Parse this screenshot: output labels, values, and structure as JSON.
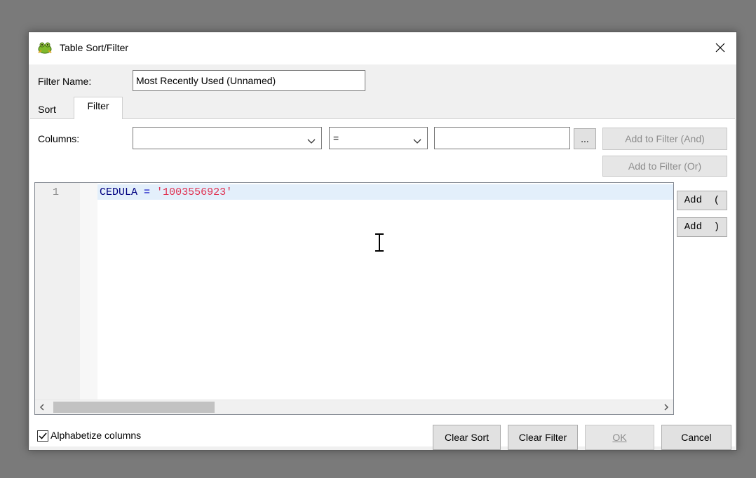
{
  "dialog": {
    "title": "Table Sort/Filter",
    "icons": {
      "app": "frog-icon",
      "close": "close-icon"
    }
  },
  "filter_name": {
    "label": "Filter Name:",
    "value": "Most Recently Used (Unnamed)"
  },
  "tabs": [
    {
      "label": "Sort",
      "active": false
    },
    {
      "label": "Filter",
      "active": true
    }
  ],
  "filter_tab": {
    "columns_label": "Columns:",
    "column_select": {
      "value": ""
    },
    "operator_select": {
      "value": "="
    },
    "value_input": {
      "value": ""
    },
    "ellipsis_label": "...",
    "add_and_label": "Add to Filter (And)",
    "add_or_label": "Add to Filter (Or)",
    "add_open_paren_label": "Add  (",
    "add_close_paren_label": "Add  )"
  },
  "editor": {
    "line_number": "1",
    "tokens": {
      "identifier": "CEDULA",
      "operator": "=",
      "string": "'1003556923'"
    }
  },
  "footer": {
    "alphabetize_label": "Alphabetize columns",
    "alphabetize_checked": true,
    "clear_sort_label": "Clear Sort",
    "clear_filter_label": "Clear Filter",
    "ok_label": "OK",
    "cancel_label": "Cancel"
  }
}
